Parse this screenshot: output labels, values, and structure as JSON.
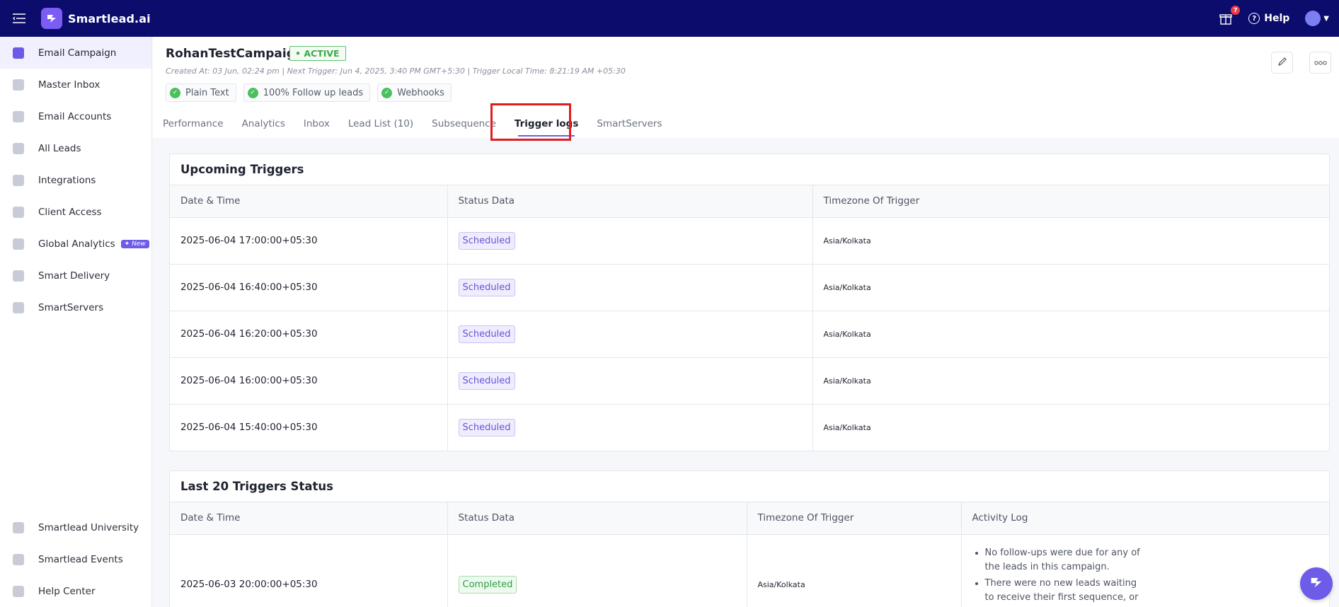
{
  "app": {
    "name": "Smartlead.ai",
    "accent": "#6c5ce7",
    "topbar_color": "#0b0c6b"
  },
  "topbar": {
    "gift_count": "7",
    "help_label": "Help"
  },
  "sidebar": {
    "items": [
      {
        "label": "Email Campaign",
        "icon": "megaphone-icon",
        "active": true
      },
      {
        "label": "Master Inbox",
        "icon": "inbox-icon"
      },
      {
        "label": "Email Accounts",
        "icon": "mail-icon"
      },
      {
        "label": "All Leads",
        "icon": "lead-icon"
      },
      {
        "label": "Integrations",
        "icon": "puzzle-icon"
      },
      {
        "label": "Client Access",
        "icon": "bolt-icon"
      },
      {
        "label": "Global Analytics",
        "icon": "bar-chart-icon",
        "badge": "✦ New"
      },
      {
        "label": "Smart Delivery",
        "icon": "layers-icon"
      },
      {
        "label": "SmartServers",
        "icon": "server-icon"
      }
    ],
    "bottom_items": [
      {
        "label": "Smartlead University",
        "icon": "university-icon"
      },
      {
        "label": "Smartlead Events",
        "icon": "grid-icon"
      },
      {
        "label": "Help Center",
        "icon": "document-icon"
      }
    ]
  },
  "campaign": {
    "title": "RohanTestCampaign",
    "status": "• ACTIVE",
    "meta": "Created At: 03 Jun, 02:24 pm | Next Trigger: Jun 4, 2025, 3:40 PM GMT+5:30 | Trigger Local Time: 8:21:19 AM +05:30",
    "tags": [
      "Plain Text",
      "100% Follow up leads",
      "Webhooks"
    ]
  },
  "tabs": [
    {
      "label": "Performance"
    },
    {
      "label": "Analytics"
    },
    {
      "label": "Inbox"
    },
    {
      "label": "Lead List (10)"
    },
    {
      "label": "Subsequence"
    },
    {
      "label": "Trigger logs",
      "active": true
    },
    {
      "label": "SmartServers"
    }
  ],
  "upcoming": {
    "title": "Upcoming Triggers",
    "columns": [
      "Date & Time",
      "Status Data",
      "Timezone Of Trigger"
    ],
    "rows": [
      {
        "datetime": "2025-06-04 17:00:00+05:30",
        "status": "Scheduled",
        "timezone": "Asia/Kolkata"
      },
      {
        "datetime": "2025-06-04 16:40:00+05:30",
        "status": "Scheduled",
        "timezone": "Asia/Kolkata"
      },
      {
        "datetime": "2025-06-04 16:20:00+05:30",
        "status": "Scheduled",
        "timezone": "Asia/Kolkata"
      },
      {
        "datetime": "2025-06-04 16:00:00+05:30",
        "status": "Scheduled",
        "timezone": "Asia/Kolkata"
      },
      {
        "datetime": "2025-06-04 15:40:00+05:30",
        "status": "Scheduled",
        "timezone": "Asia/Kolkata"
      }
    ]
  },
  "last20": {
    "title": "Last 20 Triggers Status",
    "columns": [
      "Date & Time",
      "Status Data",
      "Timezone Of Trigger",
      "Activity Log"
    ],
    "rows": [
      {
        "datetime": "2025-06-03 20:00:00+05:30",
        "status": "Completed",
        "timezone": "Asia/Kolkata",
        "activity": [
          "No follow-ups were due for any of the leads in this campaign.",
          "There were no new leads waiting to receive their first sequence, or all"
        ]
      }
    ]
  }
}
